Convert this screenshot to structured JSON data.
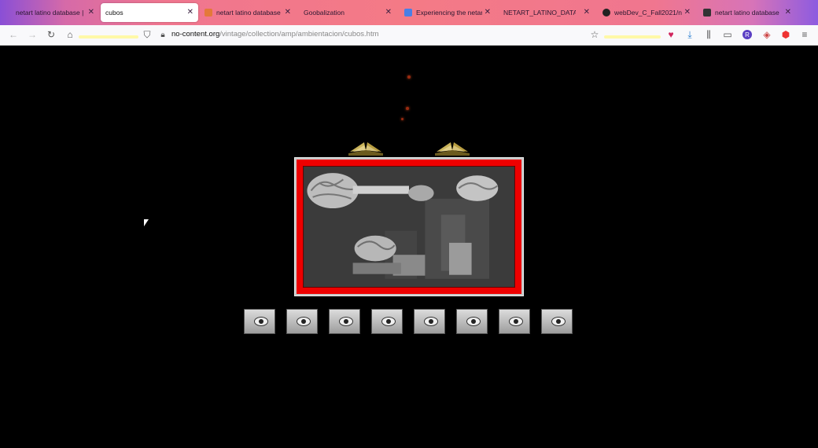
{
  "tabs": [
    {
      "title": "netart latino database |",
      "favicon": "none",
      "active": false
    },
    {
      "title": "cubos",
      "favicon": "none",
      "active": true
    },
    {
      "title": "netart latino database -",
      "favicon": "page-icon",
      "active": false
    },
    {
      "title": "Goobalization",
      "favicon": "none",
      "active": false
    },
    {
      "title": "Experiencing the netart",
      "favicon": "docs-icon",
      "active": false
    },
    {
      "title": "NETART_LATINO_DATABASE",
      "favicon": "none",
      "active": false
    },
    {
      "title": "webDev_C_Fall2021/net",
      "favicon": "github-icon",
      "active": false
    },
    {
      "title": "netart latino database",
      "favicon": "bookmark-icon",
      "active": false
    }
  ],
  "navbar": {
    "url_host": "no-content.org",
    "url_path": "/vintage/collection/amp/ambientacion/cubos.htm",
    "profile_initial": "R"
  },
  "colors": {
    "frame_red": "#ee0000",
    "background": "#000000"
  }
}
